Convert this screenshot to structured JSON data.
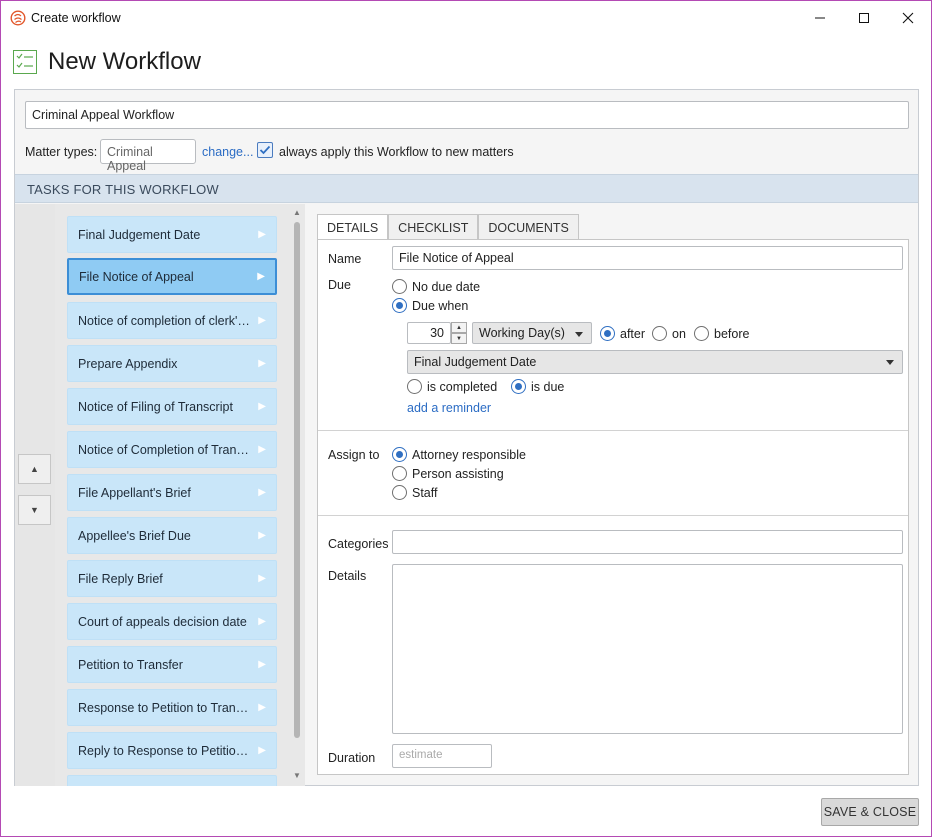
{
  "window": {
    "title": "Create workflow",
    "icon": "smokeball-logo-icon"
  },
  "header": {
    "title": "New Workflow",
    "icon": "checklist-icon"
  },
  "workflow": {
    "name_value": "Criminal Appeal Workflow",
    "matter_types_label": "Matter types:",
    "matter_type_chip": "Criminal Appeal",
    "change_link": "change...",
    "always_apply_checked": true,
    "always_apply_label": "always apply this Workflow to new matters"
  },
  "tasks_section": {
    "header": "TASKS FOR THIS WORKFLOW",
    "move_up_icon": "triangle-up-icon",
    "move_down_icon": "triangle-down-icon",
    "items": [
      {
        "label": "Final Judgement Date",
        "selected": false
      },
      {
        "label": "File Notice of Appeal",
        "selected": true
      },
      {
        "label": "Notice of completion of clerk's r...",
        "selected": false
      },
      {
        "label": "Prepare Appendix",
        "selected": false
      },
      {
        "label": "Notice of Filing of Transcript",
        "selected": false
      },
      {
        "label": "Notice of Completion of Transcript",
        "selected": false
      },
      {
        "label": "File Appellant's Brief",
        "selected": false
      },
      {
        "label": "Appellee's Brief Due",
        "selected": false
      },
      {
        "label": "File Reply Brief",
        "selected": false
      },
      {
        "label": "Court of appeals decision date",
        "selected": false
      },
      {
        "label": "Petition to Transfer",
        "selected": false
      },
      {
        "label": "Response to Petition to Transfer",
        "selected": false
      },
      {
        "label": "Reply to Response to Petition to...",
        "selected": false
      }
    ]
  },
  "tabs": [
    {
      "label": "DETAILS",
      "active": true
    },
    {
      "label": "CHECKLIST",
      "active": false
    },
    {
      "label": "DOCUMENTS",
      "active": false
    }
  ],
  "details": {
    "name_label": "Name",
    "name_value": "File Notice of Appeal",
    "due_label": "Due",
    "no_due_date": "No due date",
    "due_when": "Due when",
    "due_when_selected": true,
    "offset_value": "30",
    "unit_value": "Working Day(s)",
    "after": "after",
    "on": "on",
    "before": "before",
    "relation_selected": "after",
    "reference_task": "Final Judgement Date",
    "is_completed": "is completed",
    "is_due": "is due",
    "trigger_selected": "is due",
    "add_reminder": "add a reminder",
    "assign_label": "Assign to",
    "assign_options": [
      "Attorney responsible",
      "Person assisting",
      "Staff"
    ],
    "assign_selected": "Attorney responsible",
    "categories_label": "Categories",
    "categories_value": "",
    "details_label": "Details",
    "details_value": "",
    "duration_label": "Duration",
    "duration_placeholder": "estimate"
  },
  "footer": {
    "save_close": "SAVE & CLOSE"
  }
}
